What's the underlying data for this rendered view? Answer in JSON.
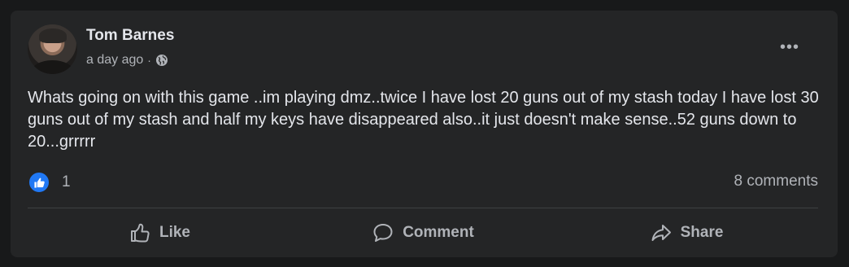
{
  "post": {
    "author": "Tom Barnes",
    "time": "a day ago",
    "separator": "·",
    "privacy_icon": "globe-icon",
    "more_icon": "more-options-icon",
    "more_label": "•••",
    "text": "Whats going on with this game ..im playing dmz..twice I have lost 20 guns out of my stash today I have lost 30 guns out of my stash and half my keys have disappeared also..it just doesn't make sense..52 guns down to 20...grrrrr",
    "reaction_count": "1",
    "comments": "8 comments"
  },
  "actions": {
    "like": "Like",
    "comment": "Comment",
    "share": "Share"
  },
  "colors": {
    "background": "#18191a",
    "card": "#242526",
    "primary_text": "#e4e6eb",
    "secondary_text": "#b0b3b8",
    "like_blue": "#2078f4"
  }
}
